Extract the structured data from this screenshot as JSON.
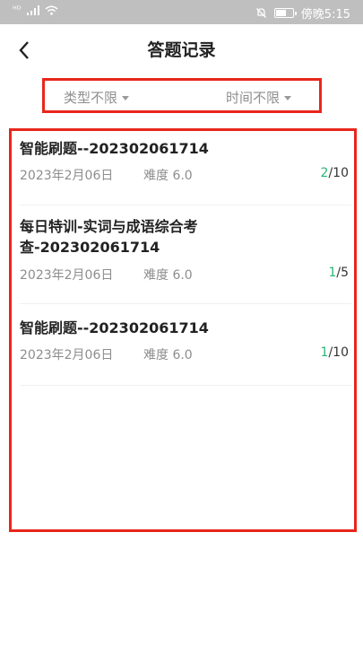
{
  "status_bar": {
    "carrier_mark": "ᴴᴰ",
    "time_text": "傍晚5:15",
    "icons": [
      "signal-icon",
      "wifi-icon",
      "bell-off-icon",
      "battery-icon"
    ]
  },
  "header": {
    "title": "答题记录",
    "back_icon": "chevron-left-icon"
  },
  "filters": {
    "type_label": "类型不限",
    "time_label": "时间不限"
  },
  "records": [
    {
      "title_line1": "智能刷题--202302061714",
      "title_line2": "",
      "date": "2023年2月06日",
      "difficulty": "难度 6.0",
      "correct": "2",
      "total": "/10"
    },
    {
      "title_line1": "每日特训-实词与成语综合考",
      "title_line2": "查-202302061714",
      "date": "2023年2月06日",
      "difficulty": "难度 6.0",
      "correct": "1",
      "total": "/5"
    },
    {
      "title_line1": "智能刷题--202302061714",
      "title_line2": "",
      "date": "2023年2月06日",
      "difficulty": "难度 6.0",
      "correct": "1",
      "total": "/10"
    }
  ],
  "colors": {
    "highlight_border": "#e8261b",
    "correct_green": "#2bb673",
    "muted_text": "#8d8d8d"
  }
}
